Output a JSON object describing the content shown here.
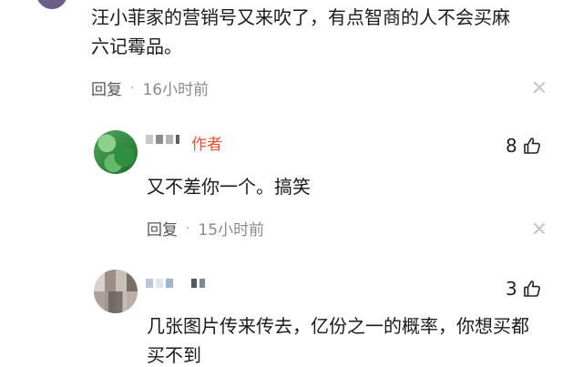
{
  "comments": [
    {
      "text_line1": "汪小菲家的营销号又来吹了，有点智商的人不会买麻",
      "text_line2": "六记霉品。",
      "reply_label": "回复",
      "time": "16小时前"
    },
    {
      "author_badge": "作者",
      "likes": "8",
      "text": "又不差你一个。搞笑",
      "reply_label": "回复",
      "time": "15小时前",
      "avatar_color": "#3e9a4a"
    },
    {
      "likes": "3",
      "text_line1": "几张图片传来传去，亿份之一的概率，你想买都",
      "text_line2": "买不到",
      "avatar_color": "#9c8e86"
    }
  ],
  "colors": {
    "author_badge": "#e0533c",
    "meta_text": "#555555",
    "time_text": "#8a8a8a",
    "close_icon": "#c4c4c4"
  },
  "icons": {
    "like": "thumbs-up-icon",
    "close": "close-icon"
  }
}
